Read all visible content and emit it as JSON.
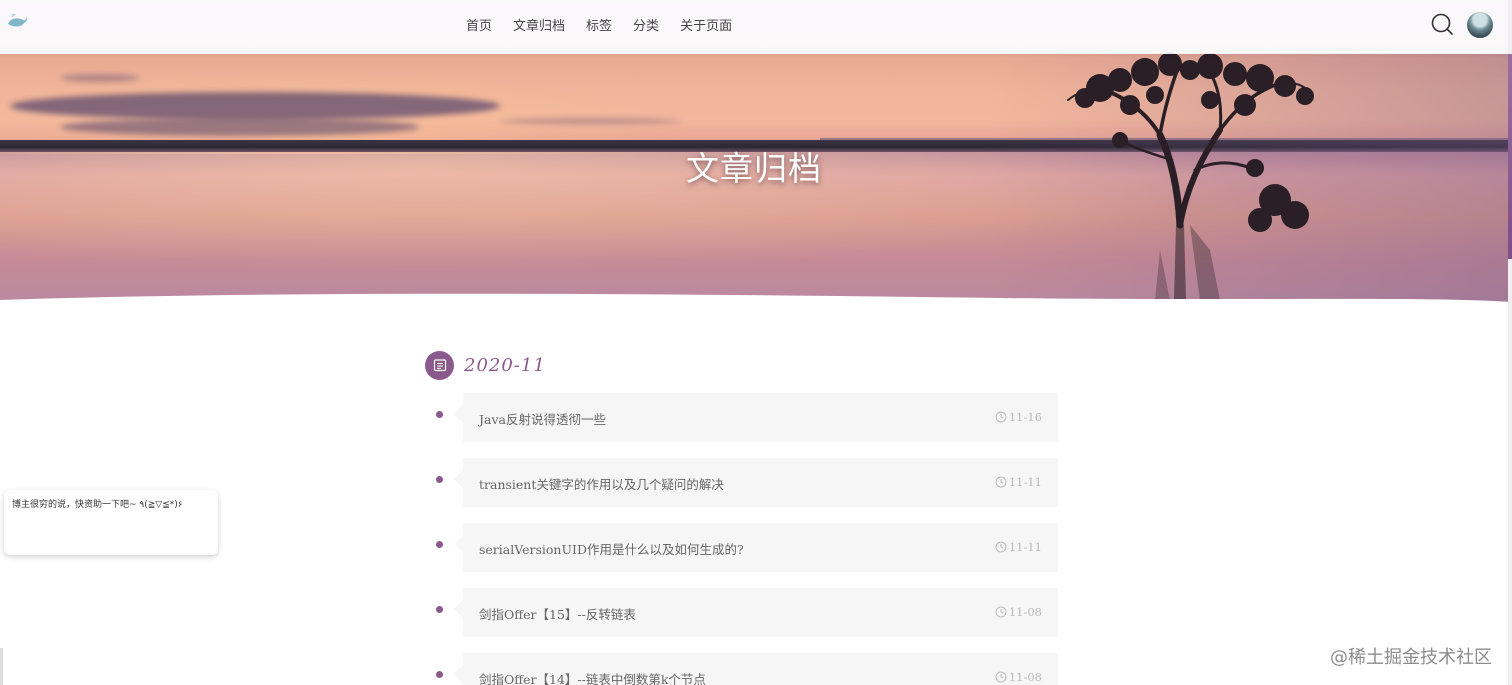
{
  "nav": {
    "links": [
      "首页",
      "文章归档",
      "标签",
      "分类",
      "关于页面"
    ],
    "search_icon": "search-icon",
    "avatar_icon": "avatar"
  },
  "hero": {
    "title": "文章归档"
  },
  "archive": {
    "month": "2020-11",
    "month_icon": "calendar-icon",
    "posts": [
      {
        "title": "Java反射说得透彻一些",
        "date": "11-16"
      },
      {
        "title": "transient关键字的作用以及几个疑问的解决",
        "date": "11-11"
      },
      {
        "title": "serialVersionUID作用是什么以及如何生成的?",
        "date": "11-11"
      },
      {
        "title": "剑指Offer【15】--反转链表",
        "date": "11-08"
      },
      {
        "title": "剑指Offer【14】--链表中倒数第k个节点",
        "date": "11-08"
      }
    ]
  },
  "donate": {
    "text": "博主很穷的说，快资助一下吧~ ٩(≧▽≦*)۶"
  },
  "watermark": "@稀土掘金技术社区",
  "colors": {
    "accent": "#8a5a8c",
    "card_bg": "#f6f6f7",
    "date_text": "#bbbbbb"
  }
}
